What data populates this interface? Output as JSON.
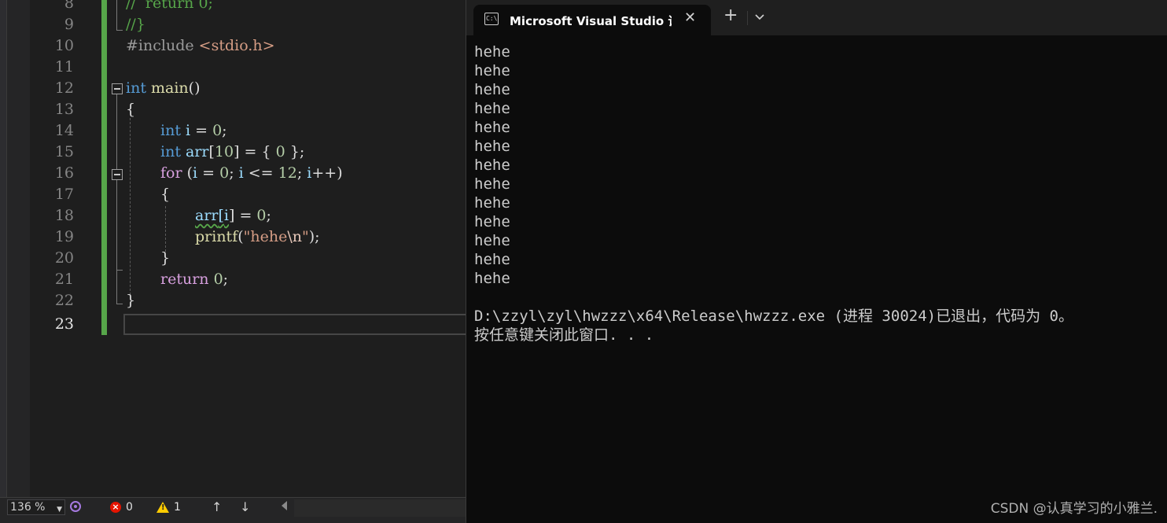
{
  "editor": {
    "line_numbers": [
      "8",
      "9",
      "10",
      "11",
      "12",
      "13",
      "14",
      "15",
      "16",
      "17",
      "18",
      "19",
      "20",
      "21",
      "22",
      "23"
    ],
    "current_line": "23",
    "code": {
      "l8": {
        "comment": "//  return 0;"
      },
      "l9": {
        "comment": "//}"
      },
      "l10": {
        "directive": "#include",
        "header": "<stdio.h>"
      },
      "l12": {
        "type": "int",
        "name": "main",
        "rest": "()"
      },
      "l13": "{",
      "l14": {
        "type": "int",
        "var": "i",
        "eq": " = ",
        "num": "0",
        "end": ";"
      },
      "l15": {
        "type": "int",
        "var": "arr",
        "open": "[",
        "num": "10",
        "close": "] = { ",
        "num2": "0",
        "end": " };"
      },
      "l16": {
        "kw": "for",
        "a": " (",
        "v1": "i",
        "b": " = ",
        "n1": "0",
        "c": "; ",
        "v2": "i",
        "d": " <= ",
        "n2": "12",
        "e": "; ",
        "v3": "i",
        "f": "++)"
      },
      "l17": "{",
      "l18": {
        "var": "arr",
        "open": "[",
        "idx": "i",
        "close": "] = ",
        "num": "0",
        "end": ";"
      },
      "l19": {
        "fn": "printf",
        "open": "(",
        "str": "\"hehe",
        "esc": "\\n",
        "strend": "\"",
        "end": ");"
      },
      "l20": "}",
      "l21": {
        "kw": "return",
        "sp": " ",
        "num": "0",
        "end": ";"
      },
      "l22": "}"
    }
  },
  "statusbar": {
    "zoom": "136 %",
    "errors": "0",
    "warnings": "1"
  },
  "terminal": {
    "tab_title": "Microsoft Visual Studio 调试控制台",
    "tab_icon_text": "C:\\",
    "output_lines": [
      "hehe",
      "hehe",
      "hehe",
      "hehe",
      "hehe",
      "hehe",
      "hehe",
      "hehe",
      "hehe",
      "hehe",
      "hehe",
      "hehe",
      "hehe"
    ],
    "exit_message": "D:\\zzyl\\zyl\\hwzzz\\x64\\Release\\hwzzz.exe (进程 30024)已退出，代码为 0。",
    "press_key_message": "按任意键关闭此窗口. . ."
  },
  "watermark": "CSDN @认真学习的小雅兰."
}
